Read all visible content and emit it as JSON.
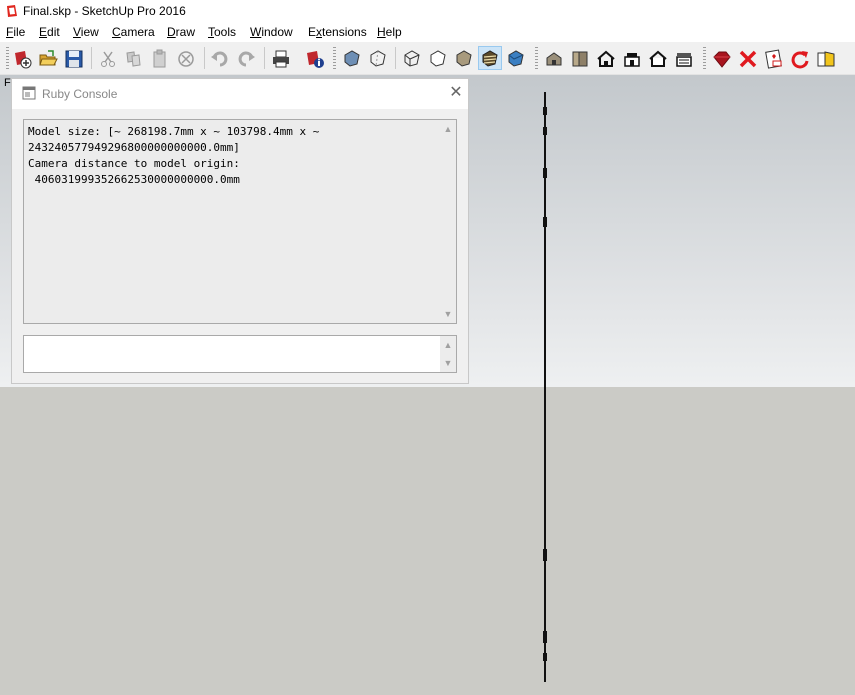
{
  "window": {
    "title": "Final.skp - SketchUp Pro 2016",
    "app_icon": "sketchup-icon",
    "brand_color": "#e0271f"
  },
  "menu": [
    {
      "label": "File",
      "accel": "F"
    },
    {
      "label": "Edit",
      "accel": "E"
    },
    {
      "label": "View",
      "accel": "V"
    },
    {
      "label": "Camera",
      "accel": "C"
    },
    {
      "label": "Draw",
      "accel": "D"
    },
    {
      "label": "Tools",
      "accel": "T"
    },
    {
      "label": "Window",
      "accel": "W"
    },
    {
      "label": "Extensions",
      "accel": "x"
    },
    {
      "label": "Help",
      "accel": "H"
    }
  ],
  "toolbar": {
    "items": [
      "new-model-icon",
      "open-icon",
      "save-icon",
      "cut-icon",
      "copy-icon",
      "paste-icon",
      "erase-icon",
      "undo-icon",
      "redo-icon",
      "print-icon",
      "model-info-icon",
      "xray-style-icon",
      "back-edges-icon",
      "wireframe-icon",
      "hidden-line-icon",
      "shaded-icon",
      "shaded-with-textures-icon",
      "monochrome-icon",
      "iso-view-icon",
      "top-view-icon",
      "front-view-icon",
      "right-view-icon",
      "back-view-icon",
      "left-view-icon",
      "ruby-icon",
      "delete-icon",
      "card-icon",
      "reload-icon",
      "folder-icon"
    ]
  },
  "viewport": {
    "corner_label": "F",
    "sky_color": "#e4e6e8",
    "ground_color": "#cbcbc6"
  },
  "ruby_console": {
    "title": "Ruby Console",
    "output_lines": [
      "Model size: [~ 268198.7mm x ~ 103798.4mm x ~",
      "243240577949296800000000000.0mm]",
      "Camera distance to model origin:",
      " 406031999352662530000000000.0mm"
    ],
    "input_value": ""
  }
}
